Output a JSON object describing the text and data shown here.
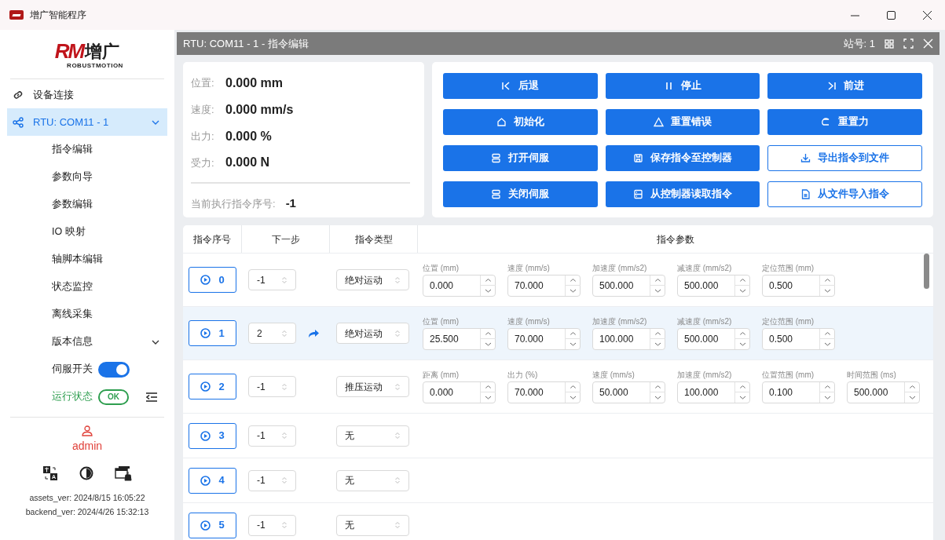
{
  "window": {
    "title": "增广智能程序"
  },
  "sidebar": {
    "logo": {
      "mark": "RM",
      "name": "增广",
      "subtitle": "ROBUSTMOTION"
    },
    "nav": [
      {
        "label": "设备连接",
        "kind": "link",
        "selected": false
      },
      {
        "label": "RTU: COM11 - 1",
        "kind": "device",
        "selected": true,
        "expanded": true,
        "children": [
          {
            "label": "指令编辑",
            "kind": "page"
          },
          {
            "label": "参数向导",
            "kind": "page"
          },
          {
            "label": "参数编辑",
            "kind": "page"
          },
          {
            "label": "IO 映射",
            "kind": "page"
          },
          {
            "label": "轴脚本编辑",
            "kind": "page"
          },
          {
            "label": "状态监控",
            "kind": "page"
          },
          {
            "label": "离线采集",
            "kind": "page"
          },
          {
            "label": "版本信息",
            "kind": "group",
            "expanded": false
          }
        ]
      }
    ],
    "servo_switch": {
      "label": "伺服开关",
      "on": true
    },
    "run_status": {
      "label": "运行状态",
      "badge": "OK"
    },
    "user": "admin",
    "versions": [
      {
        "label": "assets_ver:",
        "value": "2024/8/15 16:05:22"
      },
      {
        "label": "backend_ver:",
        "value": "2024/4/26 15:32:13"
      }
    ]
  },
  "panel": {
    "title": "RTU: COM11 - 1 - 指令编辑",
    "station": "站号: 1",
    "readouts": [
      {
        "label": "位置:",
        "value": "0.000 mm"
      },
      {
        "label": "速度:",
        "value": "0.000 mm/s"
      },
      {
        "label": "出力:",
        "value": "0.000 %"
      },
      {
        "label": "受力:",
        "value": "0.000 N"
      }
    ],
    "current": {
      "label": "当前执行指令序号:",
      "value": "-1"
    },
    "buttons": [
      {
        "label": "后退",
        "kind": "primary"
      },
      {
        "label": "停止",
        "kind": "primary"
      },
      {
        "label": "前进",
        "kind": "primary"
      },
      {
        "label": "初始化",
        "kind": "primary"
      },
      {
        "label": "重置错误",
        "kind": "primary"
      },
      {
        "label": "重置力",
        "kind": "primary"
      },
      {
        "label": "打开伺服",
        "kind": "primary"
      },
      {
        "label": "保存指令至控制器",
        "kind": "primary"
      },
      {
        "label": "导出指令到文件",
        "kind": "outline"
      },
      {
        "label": "关闭伺服",
        "kind": "primary"
      },
      {
        "label": "从控制器读取指令",
        "kind": "primary"
      },
      {
        "label": "从文件导入指令",
        "kind": "outline"
      }
    ],
    "table": {
      "columns": [
        "指令序号",
        "下一步",
        "指令类型",
        "指令参数"
      ],
      "rows": [
        {
          "index": "0",
          "next": "-1",
          "jump": false,
          "type": "绝对运动",
          "selected": false,
          "params": [
            {
              "label": "位置 (mm)",
              "value": "0.000"
            },
            {
              "label": "速度 (mm/s)",
              "value": "70.000"
            },
            {
              "label": "加速度 (mm/s2)",
              "value": "500.000"
            },
            {
              "label": "减速度 (mm/s2)",
              "value": "500.000"
            },
            {
              "label": "定位范围 (mm)",
              "value": "0.500"
            }
          ]
        },
        {
          "index": "1",
          "next": "2",
          "jump": true,
          "type": "绝对运动",
          "selected": true,
          "params": [
            {
              "label": "位置 (mm)",
              "value": "25.500"
            },
            {
              "label": "速度 (mm/s)",
              "value": "70.000"
            },
            {
              "label": "加速度 (mm/s2)",
              "value": "100.000"
            },
            {
              "label": "减速度 (mm/s2)",
              "value": "500.000"
            },
            {
              "label": "定位范围 (mm)",
              "value": "0.500"
            }
          ]
        },
        {
          "index": "2",
          "next": "-1",
          "jump": false,
          "type": "推压运动",
          "selected": false,
          "params": [
            {
              "label": "距离 (mm)",
              "value": "0.000"
            },
            {
              "label": "出力 (%)",
              "value": "70.000"
            },
            {
              "label": "速度 (mm/s)",
              "value": "50.000"
            },
            {
              "label": "加速度 (mm/s2)",
              "value": "100.000"
            },
            {
              "label": "位置范围 (mm)",
              "value": "0.100"
            },
            {
              "label": "时间范围 (ms)",
              "value": "500.000"
            }
          ]
        },
        {
          "index": "3",
          "next": "-1",
          "jump": false,
          "type": "无",
          "selected": false,
          "params": []
        },
        {
          "index": "4",
          "next": "-1",
          "jump": false,
          "type": "无",
          "selected": false,
          "params": []
        },
        {
          "index": "5",
          "next": "-1",
          "jump": false,
          "type": "无",
          "selected": false,
          "params": []
        }
      ]
    }
  }
}
